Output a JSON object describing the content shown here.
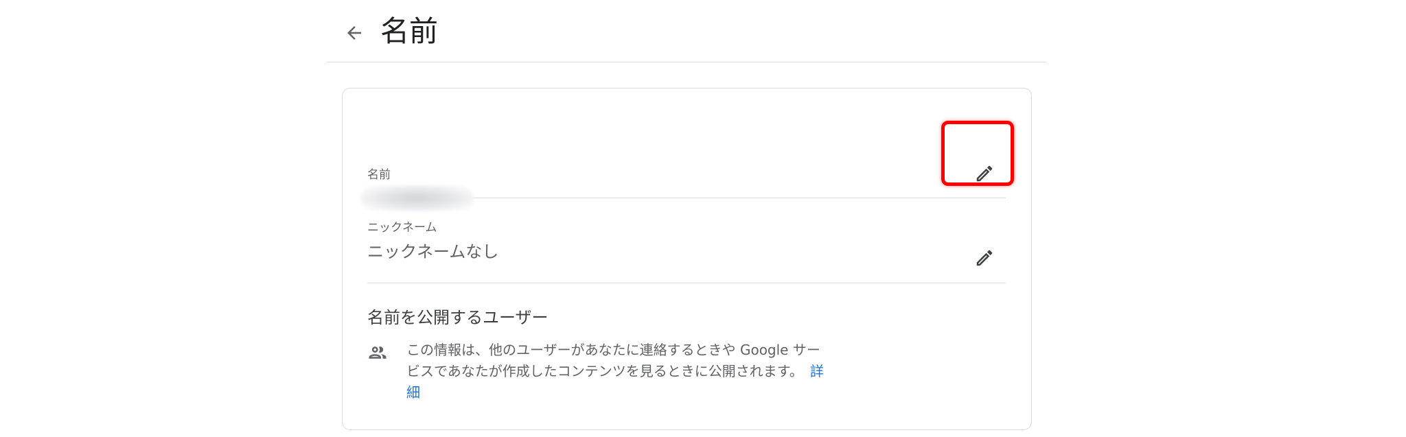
{
  "header": {
    "back_label": "←",
    "title": "名前"
  },
  "name_row": {
    "label": "名前",
    "value": ""
  },
  "nickname_row": {
    "label": "ニックネーム",
    "value": "ニックネームなし"
  },
  "visibility": {
    "title": "名前を公開するユーザー",
    "description": "この情報は、他のユーザーがあなたに連絡するときや Google サービスであなたが作成したコンテンツを見るときに公開されます。",
    "learn_more": "詳細"
  },
  "icons": {
    "back": "arrow-back-icon",
    "edit": "pencil-icon",
    "people": "people-icon"
  },
  "colors": {
    "link": "#1a73e8",
    "highlight": "#ff0000",
    "divider": "#dadce0"
  }
}
